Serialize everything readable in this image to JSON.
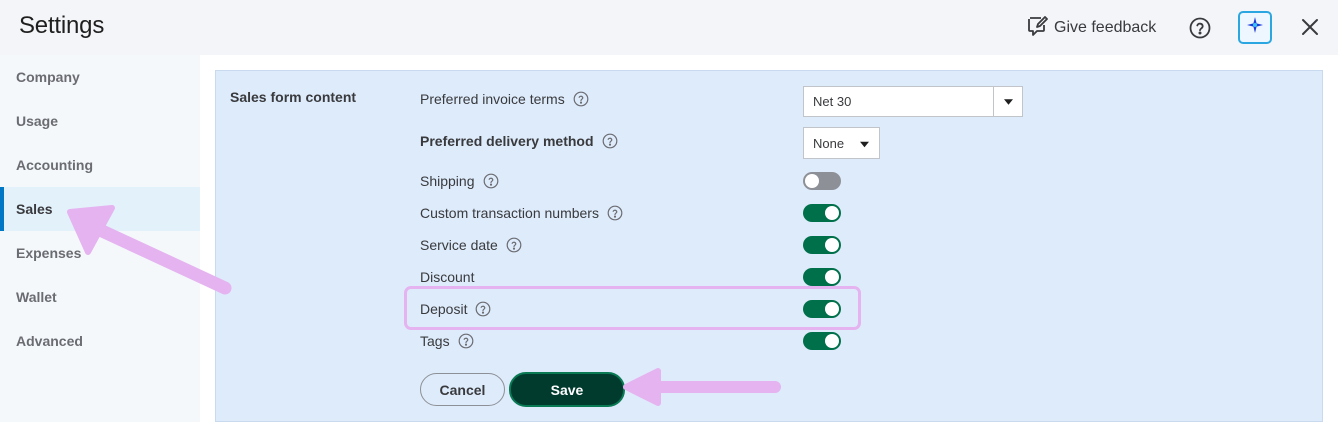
{
  "header": {
    "title": "Settings",
    "feedback_label": "Give feedback"
  },
  "sidebar": {
    "items": [
      {
        "label": "Company"
      },
      {
        "label": "Usage"
      },
      {
        "label": "Accounting"
      },
      {
        "label": "Sales",
        "active": true
      },
      {
        "label": "Expenses"
      },
      {
        "label": "Wallet"
      },
      {
        "label": "Advanced"
      }
    ]
  },
  "section": {
    "title": "Sales form content",
    "invoice_terms": {
      "label": "Preferred invoice terms",
      "value": "Net 30"
    },
    "delivery_method": {
      "label": "Preferred delivery method",
      "value": "None"
    },
    "toggles": [
      {
        "label": "Shipping",
        "on": false
      },
      {
        "label": "Custom transaction numbers",
        "on": true
      },
      {
        "label": "Service date",
        "on": true
      },
      {
        "label": "Discount",
        "on": true
      },
      {
        "label": "Deposit",
        "on": true
      },
      {
        "label": "Tags",
        "on": true
      }
    ]
  },
  "actions": {
    "cancel_label": "Cancel",
    "save_label": "Save"
  },
  "colors": {
    "toggle_on": "#00704a",
    "toggle_off": "#8d9096",
    "save_bg": "#003b2e",
    "annotation": "#e5b3f0",
    "active_nav": "#0077c5"
  }
}
